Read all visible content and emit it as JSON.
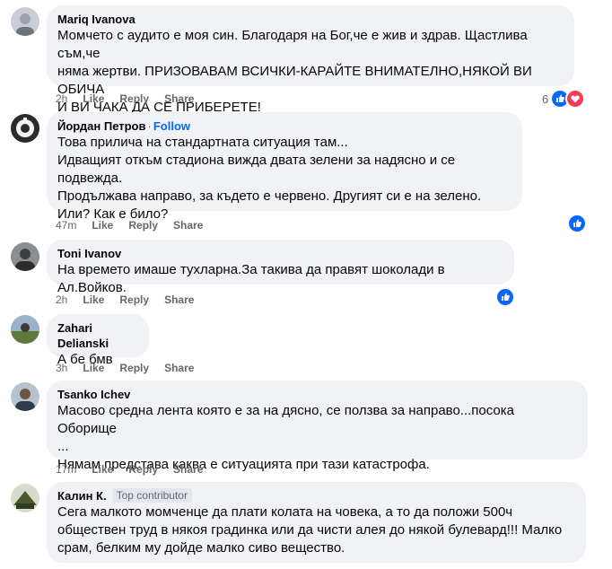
{
  "comments": [
    {
      "author": "Mariq Ivanova",
      "text": "Момчето с аудито е моя син. Благодаря на Бог,че е жив и здрав. Щастлива съм,че\nняма жертви. ПРИЗОВАВАМ ВСИЧКИ-КАРАЙТЕ ВНИМАТЕЛНО,НЯКОЙ ВИ ОБИЧА\nИ ВИ ЧАКА ДА СЕ ПРИБЕРЕТЕ!",
      "time": "2h",
      "reaction_count": "6",
      "reactions": [
        "like",
        "love"
      ]
    },
    {
      "author": "Йордан Петров",
      "follow": "Follow",
      "text": "Това прилича на стандартната ситуация там...\nИдващият откъм стадиона вижда двата зелени за надясно и се подвежда.\nПродължава направо, за където е червено. Другият си е на зелено.\nИли? Как е било?",
      "time": "47m",
      "reactions": [
        "like"
      ]
    },
    {
      "author": "Toni Ivanov",
      "text": "На времето имаше тухларна.За такива да правят шоколади в Ал.Войков.",
      "time": "2h",
      "reactions": [
        "like"
      ]
    },
    {
      "author": "Zahari Delianski",
      "text": "А бе бмв",
      "time": "3h"
    },
    {
      "author": "Tsanko Ichev",
      "text": "Масово средна лента която е за на дясно, се ползва за направо...посока Оборище\n...\nНямам представа каква е ситуацията при тази катастрофа.",
      "time": "17m"
    },
    {
      "author": "Калин К.",
      "badge": "Top contributor",
      "text": "Сега малкото момченце да плати колата на човека, а то да положи 500ч\nобществен труд в някоя градинка или да чисти алея до някой булевард!!! Малко\nсрам, белким му дойде малко сиво вещество."
    }
  ],
  "actions": {
    "like": "Like",
    "reply": "Reply",
    "share": "Share"
  },
  "colors": {
    "bubble": "#f0f2f5",
    "like_blue": "#0866ff",
    "love_red": "#f33e58",
    "meta_gray": "#65676b"
  }
}
